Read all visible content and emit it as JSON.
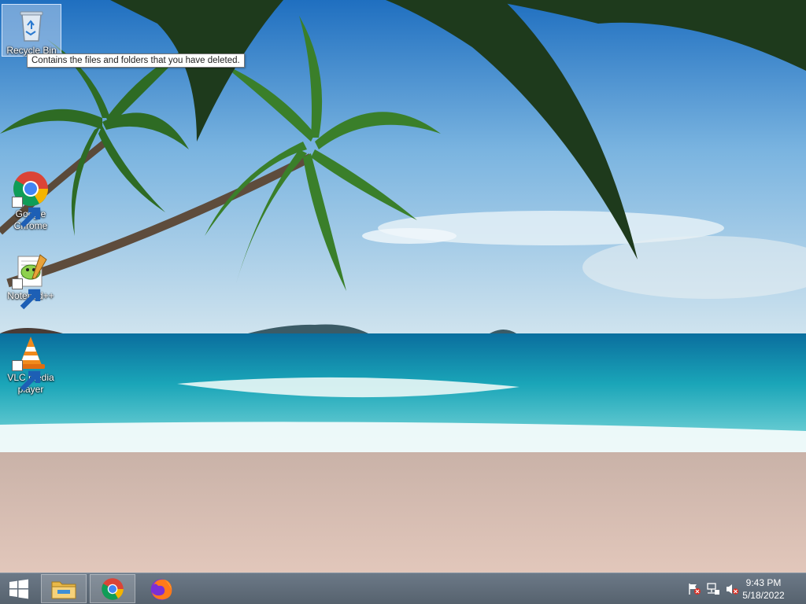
{
  "desktop": {
    "icons": [
      {
        "label": "Recycle Bin",
        "icon": "recycle-bin-icon"
      },
      {
        "label": "Google Chrome",
        "label_line1": "Google",
        "label_line2": "Chrome",
        "icon": "chrome-icon"
      },
      {
        "label": "Notepad++",
        "icon": "notepadpp-icon"
      },
      {
        "label": "VLC media player",
        "label_line1": "VLC media",
        "label_line2": "player",
        "icon": "vlc-icon"
      }
    ],
    "tooltip": "Contains the files and folders that you have deleted."
  },
  "taskbar": {
    "start_icon": "windows-logo-icon",
    "pinned": [
      {
        "name": "File Explorer",
        "icon": "file-explorer-icon"
      },
      {
        "name": "Google Chrome",
        "icon": "chrome-icon"
      },
      {
        "name": "Firefox",
        "icon": "firefox-icon"
      }
    ],
    "tray": [
      "action-center-flag-icon",
      "network-icon",
      "volume-muted-icon"
    ],
    "time": "9:43 PM",
    "date": "5/18/2022"
  },
  "colors": {
    "taskbar": "#5f6b78",
    "sky": "#7fb0d8",
    "sea": "#1aa5b8",
    "sand": "#d8c3b8"
  }
}
